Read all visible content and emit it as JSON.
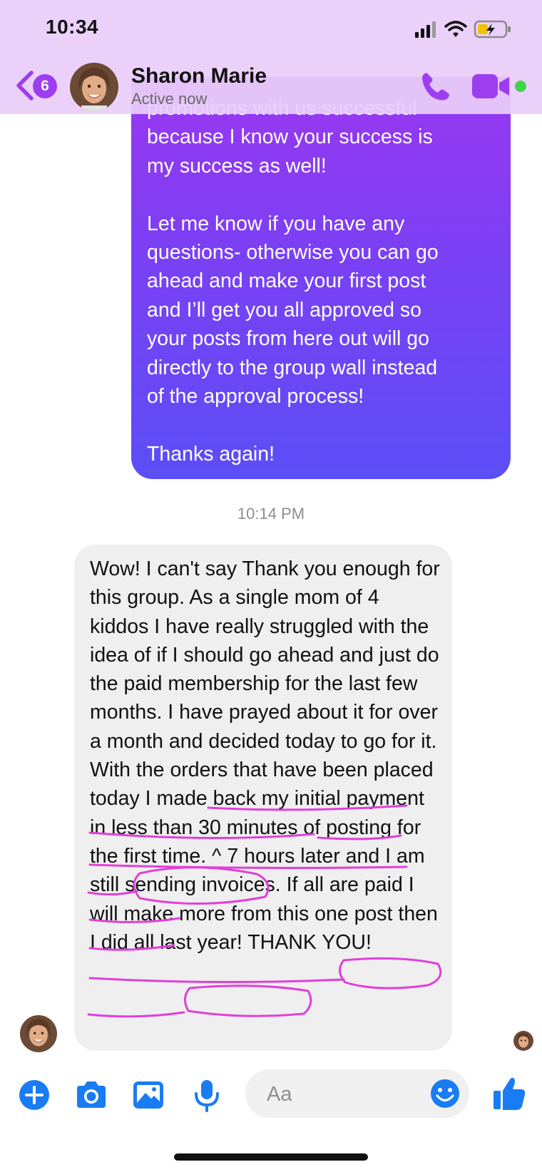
{
  "status_bar": {
    "time": "10:34"
  },
  "header": {
    "back_badge_count": "6",
    "contact_name": "Sharon Marie",
    "contact_status": "Active now",
    "icons": {
      "back": "chevron-left-icon",
      "call": "phone-icon",
      "video": "video-camera-icon",
      "online": "online-status-dot"
    }
  },
  "conversation": {
    "sent_message": "promotions with us successful\nbecause I know your success is\nmy success as well!\n\nLet me know if you have any\nquestions- otherwise you can go\nahead and make your first post\nand I’ll get you all approved so\nyour posts from here out will go\ndirectly to the group wall instead\nof the approval process!\n\nThanks again!",
    "timestamp": "10:14 PM",
    "received_message": "Wow! I can't say Thank you enough for this group. As a single mom of 4 kiddos I have really struggled with the idea of if I should go ahead and just do the paid membership for the last few months. I have prayed about it for over a month and decided today to go for it. With the orders that have been placed today I made back my initial payment in less than 30 minutes of posting for the first time. ^ 7 hours later and I am still sending invoices. If all are paid I will make more from this one post then I did all last year! THANK YOU!"
  },
  "composer": {
    "placeholder": "Aa",
    "icons": [
      "plus-icon",
      "camera-icon",
      "gallery-icon",
      "microphone-icon",
      "emoji-icon",
      "thumbs-up-icon"
    ]
  },
  "colors": {
    "top_band": "#e9cefa",
    "accent_purple": "#9d3df0",
    "sent_gradient_top": "#9a37f0",
    "sent_gradient_bottom": "#5c4ef6",
    "received_bubble": "#efefef",
    "composer_blue": "#1a7cf2",
    "annotation_magenta": "#e040d8",
    "online_green": "#3fd34a"
  }
}
